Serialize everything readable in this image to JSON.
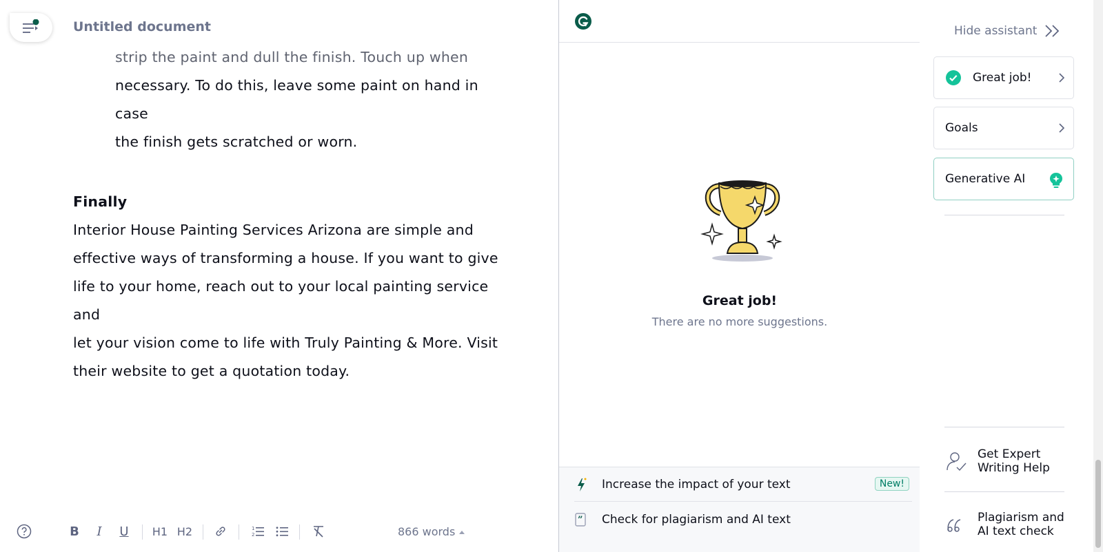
{
  "editor": {
    "title": "Untitled document",
    "indented_lines": [
      "strip the paint and dull the finish. Touch up when",
      "necessary. To do this, leave some paint on hand in case",
      "the finish gets scratched or worn."
    ],
    "heading": "Finally",
    "paragraph_lines": [
      "Interior House Painting Services Arizona are simple and",
      "effective ways of transforming a house. If you want to give",
      "life to your home, reach out to your local painting service and",
      "let your vision come to life with Truly Painting & More. Visit",
      "their website to get a quotation today."
    ],
    "toolbar": {
      "bold": "B",
      "italic": "I",
      "underline": "U",
      "h1": "H1",
      "h2": "H2",
      "word_count": "866 words"
    }
  },
  "panel": {
    "great_title": "Great job!",
    "great_sub": "There are no more suggestions.",
    "footer": {
      "impact_label": "Increase the impact of your text",
      "new_badge": "New!",
      "plagiarism_label": "Check for plagiarism and AI text"
    }
  },
  "assistant": {
    "hide_label": "Hide assistant",
    "cards": {
      "great": "Great job!",
      "goals": "Goals",
      "ai": "Generative AI"
    },
    "expert_lines": [
      "Get Expert",
      "Writing Help"
    ],
    "plagiarism_lines": [
      "Plagiarism and",
      "AI text check"
    ]
  },
  "colors": {
    "brand_green": "#15c39a",
    "dark_green": "#0a5c4a"
  }
}
